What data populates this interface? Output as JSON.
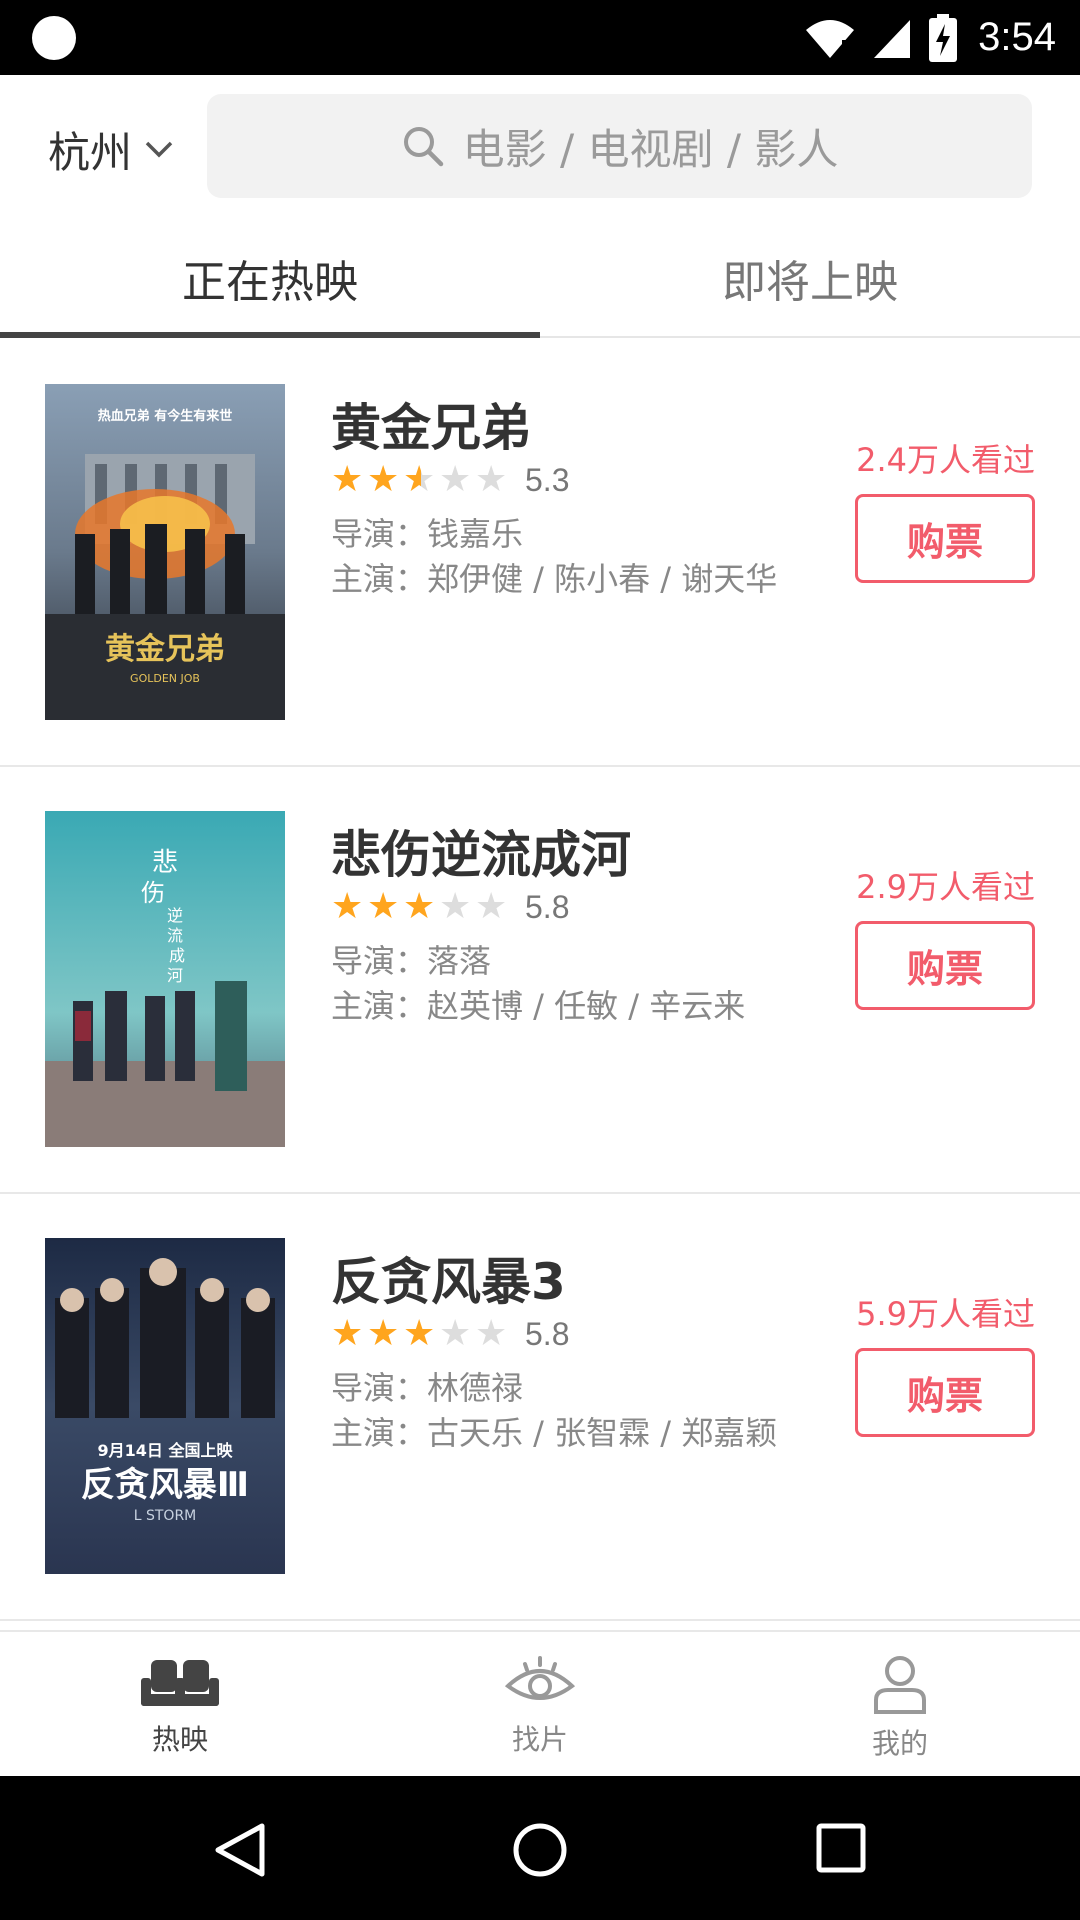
{
  "status_bar": {
    "time": "3:54",
    "icons": [
      "wifi-icon",
      "signal-icon",
      "battery-charging-icon"
    ]
  },
  "header": {
    "city": "杭州",
    "search_placeholder": "电影 / 电视剧 / 影人"
  },
  "tabs": [
    {
      "label": "正在热映",
      "active": true
    },
    {
      "label": "即将上映",
      "active": false
    }
  ],
  "movies": [
    {
      "title": "黄金兄弟",
      "stars": 2.5,
      "score": "5.3",
      "director": "导演：钱嘉乐",
      "cast": "主演：郑伊健 / 陈小春 / 谢天华",
      "watched": "2.4万人看过",
      "buy_label": "购票"
    },
    {
      "title": "悲伤逆流成河",
      "stars": 3,
      "score": "5.8",
      "director": "导演：落落",
      "cast": "主演：赵英博 / 任敏 / 辛云来",
      "watched": "2.9万人看过",
      "buy_label": "购票"
    },
    {
      "title": "反贪风暴3",
      "stars": 3,
      "score": "5.8",
      "director": "导演：林德禄",
      "cast": "主演：古天乐 / 张智霖 / 郑嘉颖",
      "watched": "5.9万人看过",
      "buy_label": "购票"
    }
  ],
  "bottom_nav": [
    {
      "label": "热映",
      "icon": "theater-seats-icon",
      "active": true
    },
    {
      "label": "找片",
      "icon": "eye-icon",
      "active": false
    },
    {
      "label": "我的",
      "icon": "person-icon",
      "active": false
    }
  ],
  "colors": {
    "accent": "#f25c6b",
    "star": "#ffa51e",
    "search_bg": "#f2f2f2"
  }
}
